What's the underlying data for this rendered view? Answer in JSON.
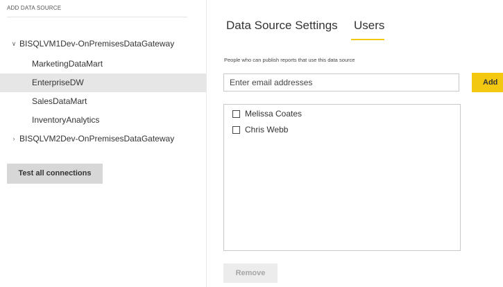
{
  "sidebar": {
    "heading": "ADD DATA SOURCE",
    "gateways": [
      {
        "name": "BISQLVM1Dev-OnPremisesDataGateway",
        "chevron": "chevron-down-icon",
        "expanded": true,
        "sources": [
          {
            "name": "MarketingDataMart",
            "selected": false
          },
          {
            "name": "EnterpriseDW",
            "selected": true
          },
          {
            "name": "SalesDataMart",
            "selected": false
          },
          {
            "name": "InventoryAnalytics",
            "selected": false
          }
        ]
      },
      {
        "name": "BISQLVM2Dev-OnPremisesDataGateway",
        "chevron": "chevron-right-icon",
        "expanded": false
      }
    ],
    "test_button_label": "Test all connections"
  },
  "tabs": [
    {
      "label": "Data Source Settings",
      "active": false
    },
    {
      "label": "Users",
      "active": true
    }
  ],
  "users_panel": {
    "helper_text": "People who can publish reports that use this data source",
    "email_placeholder": "Enter email addresses",
    "email_value": "",
    "add_button_label": "Add",
    "users": [
      {
        "name": "Melissa Coates",
        "checked": false
      },
      {
        "name": "Chris Webb",
        "checked": false
      }
    ],
    "remove_button_label": "Remove",
    "remove_disabled": true
  },
  "colors": {
    "accent": "#f2c811",
    "selected_row": "#e6e6e6",
    "button_gray": "#d7d7d7",
    "disabled_text": "#a6a6a6"
  }
}
